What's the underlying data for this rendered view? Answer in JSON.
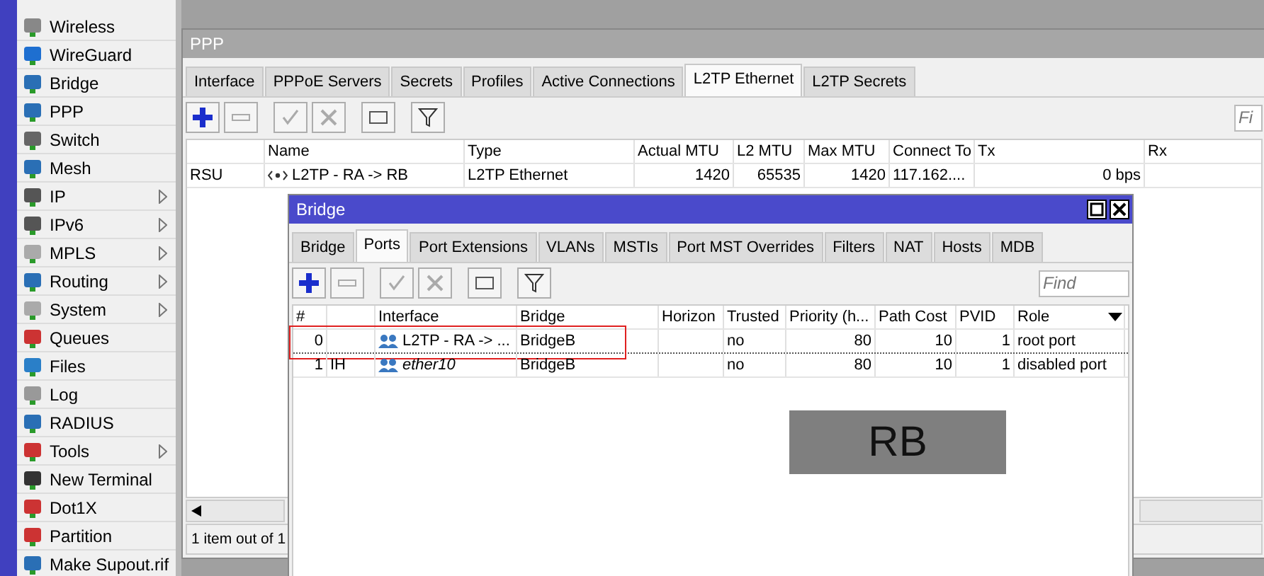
{
  "sidebar": {
    "items": [
      {
        "label": "Wireless",
        "has_submenu": false
      },
      {
        "label": "WireGuard",
        "has_submenu": false
      },
      {
        "label": "Bridge",
        "has_submenu": false
      },
      {
        "label": "PPP",
        "has_submenu": false
      },
      {
        "label": "Switch",
        "has_submenu": false
      },
      {
        "label": "Mesh",
        "has_submenu": false
      },
      {
        "label": "IP",
        "has_submenu": true
      },
      {
        "label": "IPv6",
        "has_submenu": true
      },
      {
        "label": "MPLS",
        "has_submenu": true
      },
      {
        "label": "Routing",
        "has_submenu": true
      },
      {
        "label": "System",
        "has_submenu": true
      },
      {
        "label": "Queues",
        "has_submenu": false
      },
      {
        "label": "Files",
        "has_submenu": false
      },
      {
        "label": "Log",
        "has_submenu": false
      },
      {
        "label": "RADIUS",
        "has_submenu": false
      },
      {
        "label": "Tools",
        "has_submenu": true
      },
      {
        "label": "New Terminal",
        "has_submenu": false
      },
      {
        "label": "Dot1X",
        "has_submenu": false
      },
      {
        "label": "Partition",
        "has_submenu": false
      },
      {
        "label": "Make Supout.rif",
        "has_submenu": false
      }
    ]
  },
  "ppp_window": {
    "title": "PPP",
    "tabs": [
      {
        "label": "Interface",
        "selected": false
      },
      {
        "label": "PPPoE Servers",
        "selected": false
      },
      {
        "label": "Secrets",
        "selected": false
      },
      {
        "label": "Profiles",
        "selected": false
      },
      {
        "label": "Active Connections",
        "selected": false
      },
      {
        "label": "L2TP Ethernet",
        "selected": true
      },
      {
        "label": "L2TP Secrets",
        "selected": false
      }
    ],
    "find": {
      "placeholder": "Fi"
    },
    "table": {
      "columns": [
        "",
        "Name",
        "Type",
        "Actual MTU",
        "L2 MTU",
        "Max MTU",
        "Connect To",
        "Tx",
        "Rx"
      ],
      "rows": [
        {
          "cells": [
            "RSU",
            "L2TP - RA -> RB",
            "L2TP Ethernet",
            "1420",
            "65535",
            "1420",
            "117.162....",
            "0 bps"
          ]
        }
      ]
    },
    "status_bar": "1 item out of 1"
  },
  "bridge_window": {
    "title": "Bridge",
    "tabs": [
      {
        "label": "Bridge",
        "selected": false
      },
      {
        "label": "Ports",
        "selected": true
      },
      {
        "label": "Port Extensions",
        "selected": false
      },
      {
        "label": "VLANs",
        "selected": false
      },
      {
        "label": "MSTIs",
        "selected": false
      },
      {
        "label": "Port MST Overrides",
        "selected": false
      },
      {
        "label": "Filters",
        "selected": false
      },
      {
        "label": "NAT",
        "selected": false
      },
      {
        "label": "Hosts",
        "selected": false
      },
      {
        "label": "MDB",
        "selected": false
      }
    ],
    "find": {
      "placeholder": "Find"
    },
    "table": {
      "columns": [
        "#",
        "",
        "Interface",
        "Bridge",
        "Horizon",
        "Trusted",
        "Priority (h...",
        "Path Cost",
        "PVID",
        "Role"
      ],
      "rows": [
        {
          "cells": [
            "0",
            "",
            "L2TP - RA -> ...",
            "BridgeB",
            "",
            "no",
            "80",
            "10",
            "1",
            "root port"
          ],
          "inactive": false,
          "highlighted": true
        },
        {
          "cells": [
            "1",
            "IH",
            "ether10",
            "BridgeB",
            "",
            "no",
            "80",
            "10",
            "1",
            "disabled port"
          ],
          "inactive": true,
          "highlighted": false
        }
      ]
    }
  },
  "overlay_label": "RB"
}
